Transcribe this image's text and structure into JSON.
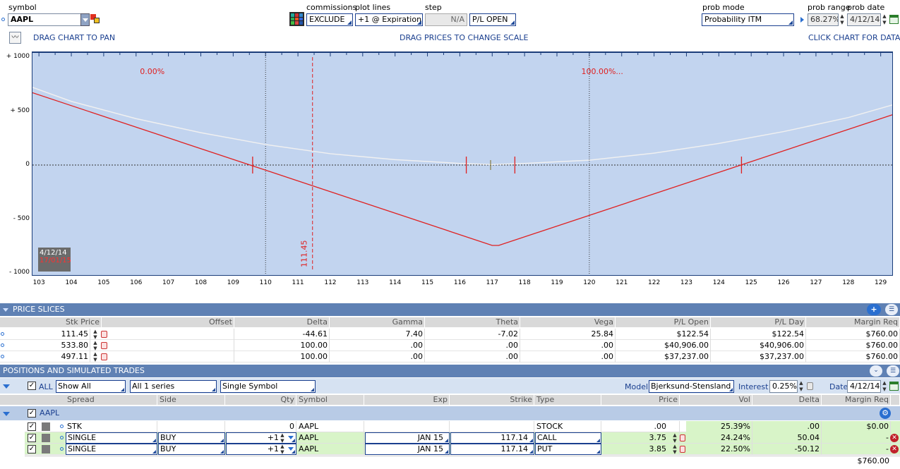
{
  "top": {
    "symbol_label": "symbol",
    "symbol_value": "AAPL",
    "commissions_label": "commissions",
    "commissions_value": "EXCLUDE",
    "plot_lines_label": "plot lines",
    "plot_lines_value": "+1 @ Expiration",
    "step_label": "step",
    "step_value": "N/A",
    "pl_mode_value": "P/L OPEN",
    "prob_mode_label": "prob mode",
    "prob_mode_value": "Probability ITM",
    "prob_range_label": "prob range",
    "prob_range_value": "68.27%",
    "prob_date_label": "prob date",
    "prob_date_value": "4/12/14"
  },
  "hints": {
    "pan": "DRAG CHART TO PAN",
    "scale": "DRAG PRICES TO CHANGE SCALE",
    "data": "CLICK CHART FOR DATA"
  },
  "chart_data": {
    "type": "line",
    "x_ticks": [
      "103",
      "104",
      "105",
      "106",
      "107",
      "108",
      "109",
      "110",
      "111",
      "112",
      "113",
      "114",
      "115",
      "116",
      "117",
      "118",
      "119",
      "120",
      "121",
      "122",
      "123",
      "124",
      "125",
      "126",
      "127",
      "128",
      "129"
    ],
    "y_ticks": [
      "+ 1000",
      "+ 500",
      "0",
      "- 500",
      "- 1000"
    ],
    "xlim": [
      102.8,
      129.4
    ],
    "ylim": [
      -1000,
      1000
    ],
    "series": [
      {
        "values_x": [
          102.8,
          117.0,
          117.2,
          129.4
        ],
        "values_y": [
          670,
          -745,
          -745,
          470
        ],
        "color": "#e02020"
      },
      {
        "values_x": [
          102.8,
          104,
          106,
          108,
          110,
          112,
          114,
          116,
          117,
          118,
          120,
          122,
          124,
          126,
          128,
          129.4
        ],
        "values_y": [
          720,
          590,
          430,
          300,
          190,
          105,
          50,
          15,
          5,
          15,
          45,
          110,
          200,
          310,
          440,
          560
        ],
        "color": "#f0f0f0"
      }
    ],
    "prob_labels": [
      "0.00%",
      "100.00%..."
    ],
    "stock_price_line": "111.45",
    "date_badge": [
      "4/12/14",
      "17/01/15"
    ]
  },
  "price_slices": {
    "title": "PRICE SLICES",
    "columns": [
      "Stk Price",
      "Offset",
      "Delta",
      "Gamma",
      "Theta",
      "Vega",
      "P/L Open",
      "P/L Day",
      "Margin Req"
    ],
    "rows": [
      [
        "111.45",
        "",
        "-44.61",
        "7.40",
        "-7.02",
        "25.84",
        "$122.54",
        "$122.54",
        "$760.00"
      ],
      [
        "533.80",
        "",
        "100.00",
        ".00",
        ".00",
        ".00",
        "$40,906.00",
        "$40,906.00",
        "$760.00"
      ],
      [
        "497.11",
        "",
        "100.00",
        ".00",
        ".00",
        ".00",
        "$37,237.00",
        "$37,237.00",
        "$760.00"
      ]
    ]
  },
  "positions": {
    "title": "POSITIONS AND SIMULATED TRADES",
    "all_label": "ALL",
    "show_all": "Show All",
    "series": "All 1 series",
    "single_symbol": "Single Symbol",
    "model_label": "Model",
    "model_value": "Bjerksund-Stensland",
    "interest_label": "Interest",
    "interest_value": "0.25%",
    "date_label": "Date",
    "date_value": "4/12/14",
    "columns": [
      "Spread",
      "Side",
      "Qty",
      "Symbol",
      "Exp",
      "Strike",
      "Type",
      "Price",
      "Vol",
      "Delta",
      "Margin Req"
    ],
    "group": "AAPL",
    "rows": [
      [
        "STK",
        "",
        "0",
        "AAPL",
        "",
        "",
        "STOCK",
        ".00",
        "25.39%",
        ".00",
        "$0.00"
      ],
      [
        "SINGLE",
        "BUY",
        "+1",
        "AAPL",
        "JAN 15",
        "117.14",
        "CALL",
        "3.75",
        "24.24%",
        "50.04",
        "-"
      ],
      [
        "SINGLE",
        "BUY",
        "+1",
        "AAPL",
        "JAN 15",
        "117.14",
        "PUT",
        "3.85",
        "22.50%",
        "-50.12",
        "-"
      ]
    ],
    "total_margin": "$760.00"
  }
}
